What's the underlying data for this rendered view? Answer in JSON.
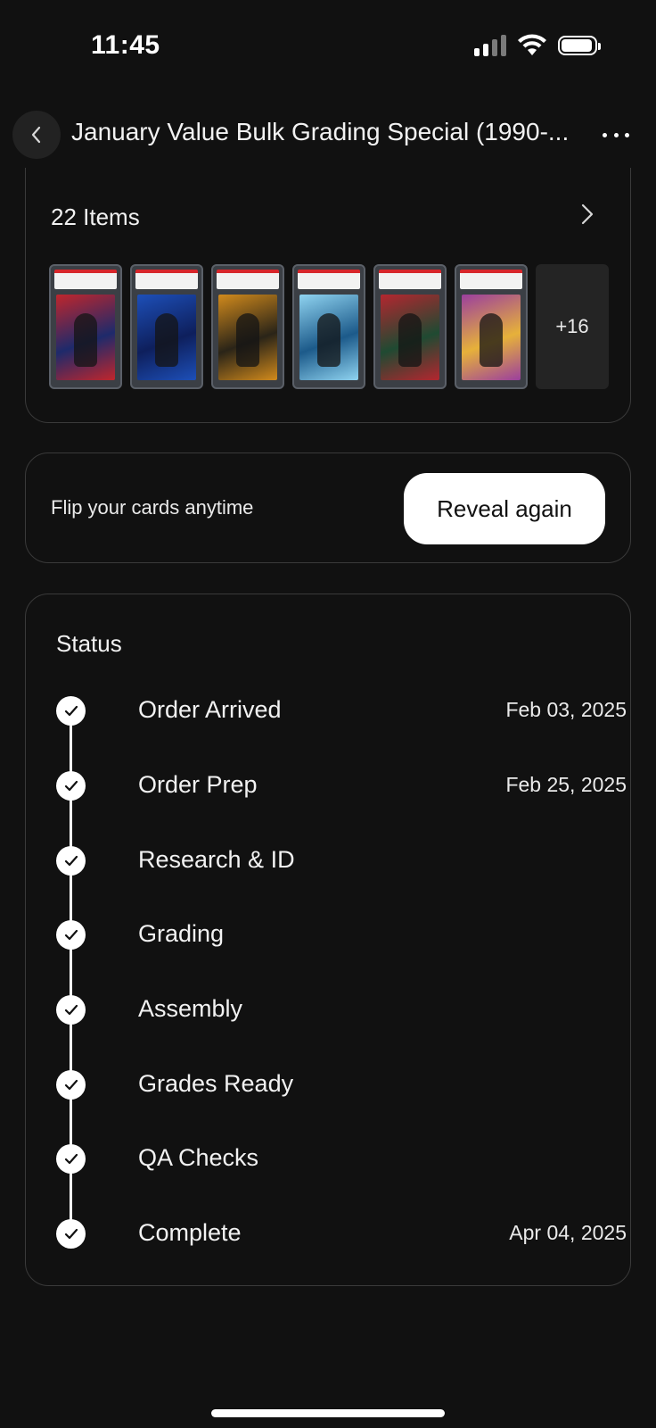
{
  "status_bar": {
    "time": "11:45",
    "icons": [
      "signal-icon",
      "wifi-icon",
      "battery-icon"
    ]
  },
  "header": {
    "title": "January Value Bulk Grading Special (1990-...",
    "back_icon": "chevron-left-icon",
    "more_icon": "ellipsis-icon"
  },
  "items": {
    "title": "22 Items",
    "more_count": "+16",
    "thumbnails": [
      {
        "art": "#c0262c",
        "accent": "#1e2a6b"
      },
      {
        "art": "#1d4fb8",
        "accent": "#0e1f5c"
      },
      {
        "art": "#d18a1c",
        "accent": "#2a2418"
      },
      {
        "art": "#8fd3f0",
        "accent": "#1c5a8a"
      },
      {
        "art": "#b4262f",
        "accent": "#1f4a32"
      },
      {
        "art": "#9b3f9e",
        "accent": "#e6b13a"
      }
    ]
  },
  "flip": {
    "text": "Flip your cards anytime",
    "button_label": "Reveal again"
  },
  "status": {
    "title": "Status",
    "steps": [
      {
        "name": "Order Arrived",
        "date": "Feb 03, 2025"
      },
      {
        "name": "Order Prep",
        "date": "Feb 25, 2025"
      },
      {
        "name": "Research & ID",
        "date": ""
      },
      {
        "name": "Grading",
        "date": ""
      },
      {
        "name": "Assembly",
        "date": ""
      },
      {
        "name": "Grades Ready",
        "date": ""
      },
      {
        "name": "QA Checks",
        "date": ""
      },
      {
        "name": "Complete",
        "date": "Apr 04, 2025"
      }
    ]
  }
}
